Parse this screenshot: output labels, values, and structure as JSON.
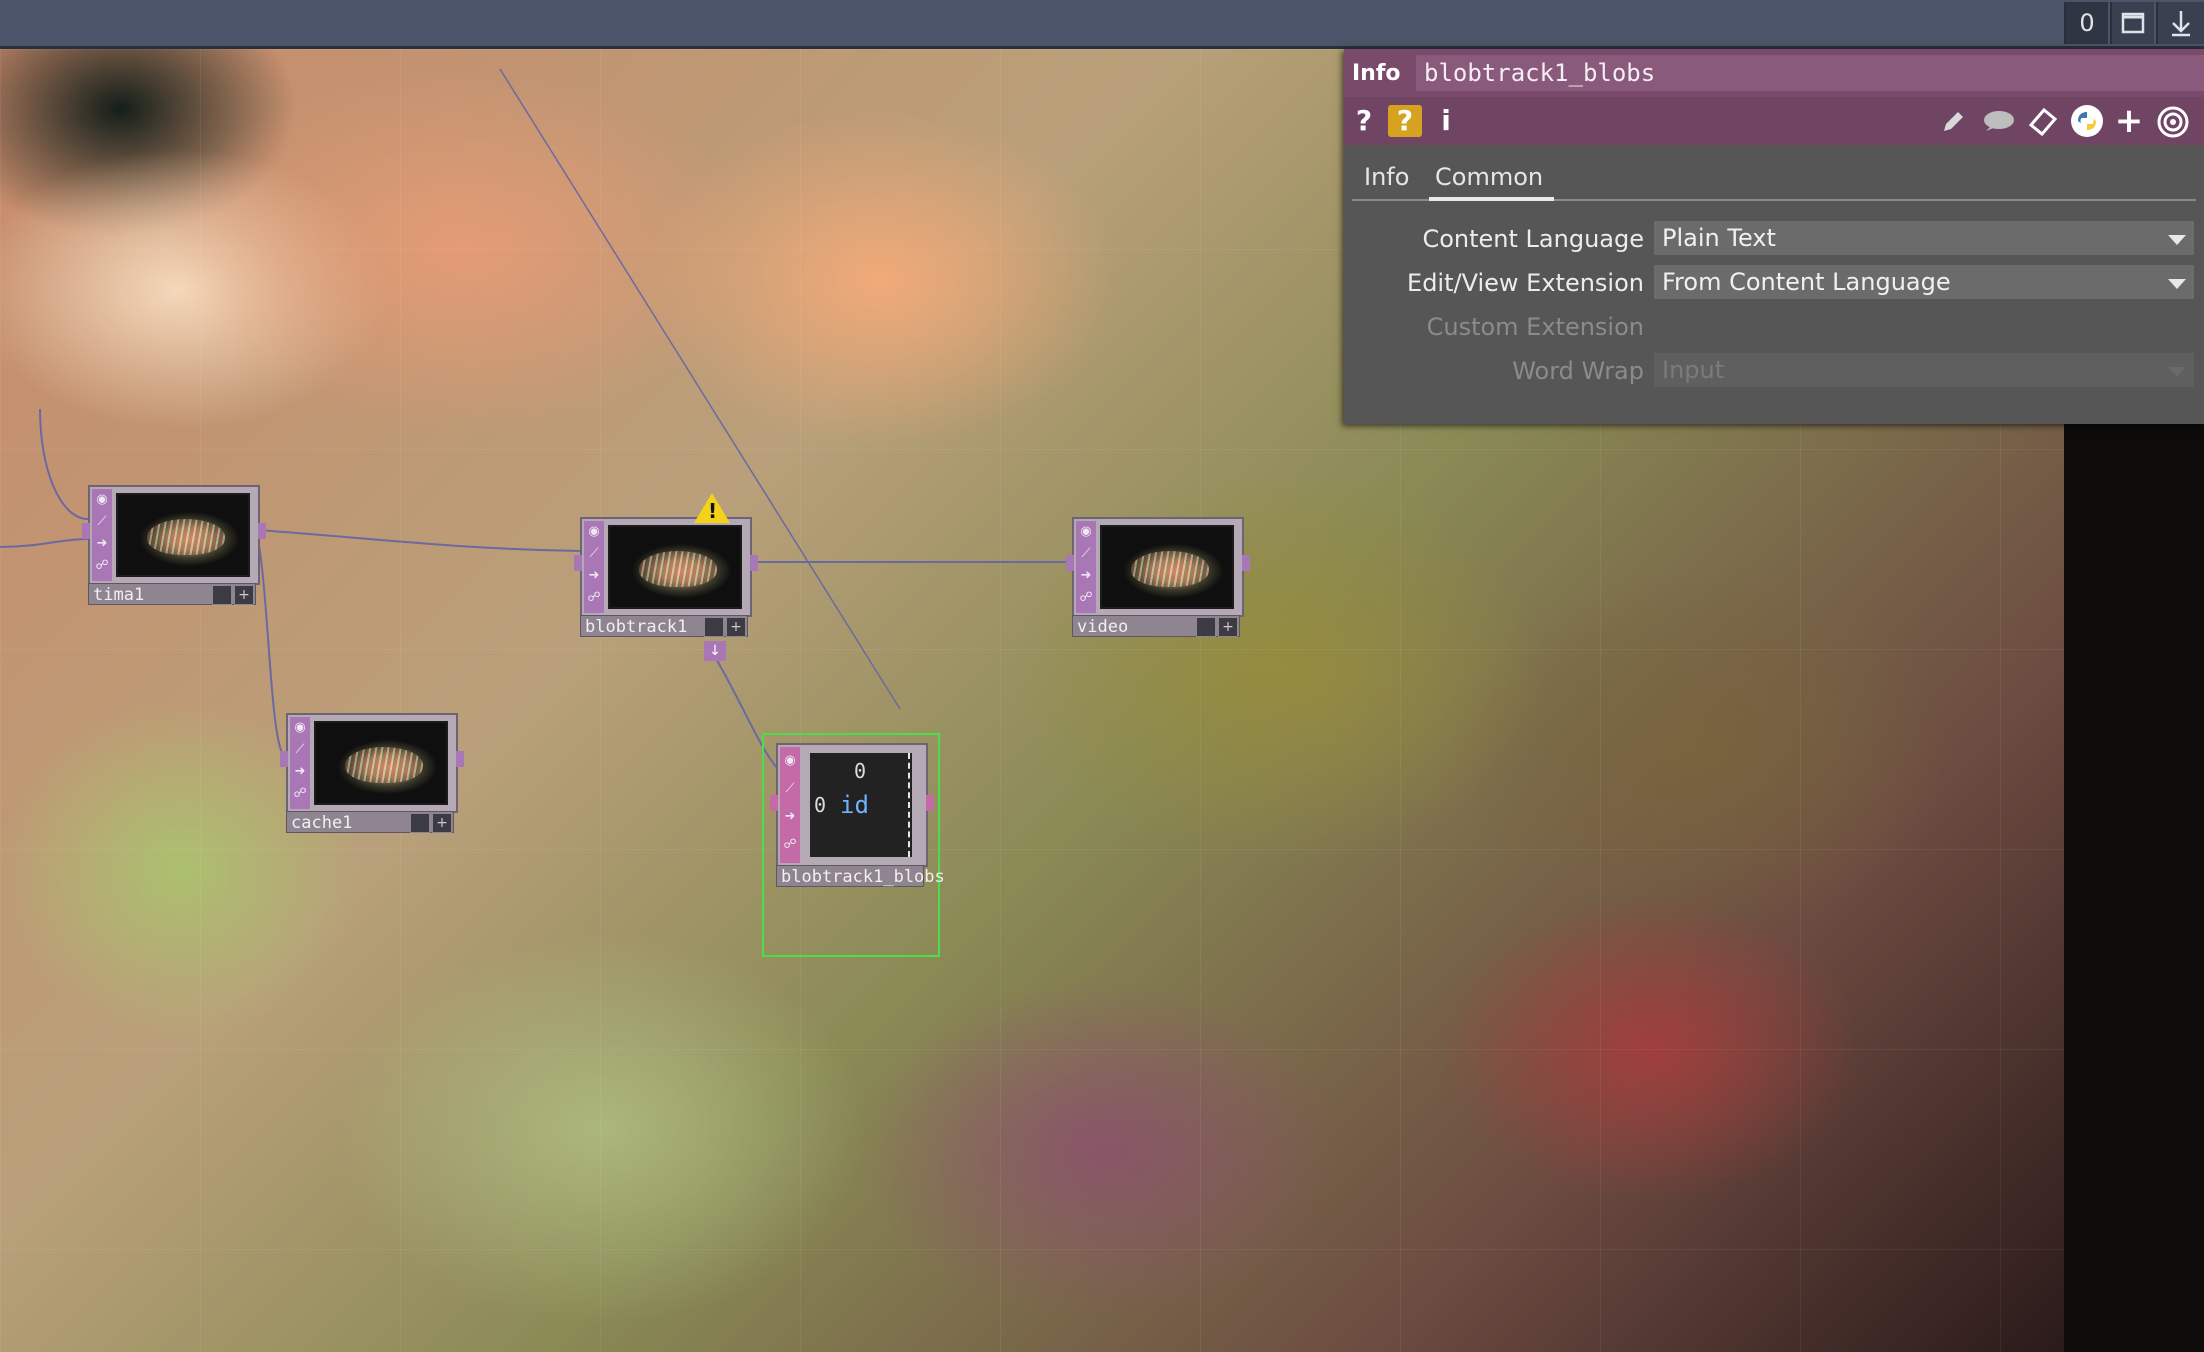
{
  "topbar": {
    "counter": "0",
    "buttons": [
      "window-icon",
      "download-arrow-icon"
    ]
  },
  "nodes": {
    "tima1": {
      "label": "tima1"
    },
    "cache1": {
      "label": "cache1"
    },
    "blobtrack1": {
      "label": "blobtrack1",
      "warning": "!"
    },
    "video": {
      "label": "video"
    },
    "blobs": {
      "label": "blobtrack1_blobs",
      "table": {
        "header": "0",
        "row_index": "0",
        "cell": "id"
      }
    }
  },
  "panel": {
    "type_label": "Info",
    "operator_name": "blobtrack1_blobs",
    "tools_left": [
      "help-icon",
      "operator-help-icon",
      "info-icon"
    ],
    "tools_right": [
      "edit-icon",
      "comment-icon",
      "bookmark-icon",
      "python-icon",
      "add-icon",
      "target-icon"
    ],
    "tabs": [
      {
        "label": "Info",
        "active": false
      },
      {
        "label": "Common",
        "active": true
      }
    ],
    "params": [
      {
        "label": "Content Language",
        "value": "Plain Text",
        "enabled": true
      },
      {
        "label": "Edit/View Extension",
        "value": "From Content Language",
        "enabled": true
      },
      {
        "label": "Custom Extension",
        "value": "",
        "enabled": false
      },
      {
        "label": "Word Wrap",
        "value": "Input",
        "enabled": false
      }
    ]
  },
  "colors": {
    "topbar": "#4b5468",
    "panel_header": "#7a4a6b",
    "op_strip": "#a977b5",
    "dat_selected": "#48e04a"
  }
}
